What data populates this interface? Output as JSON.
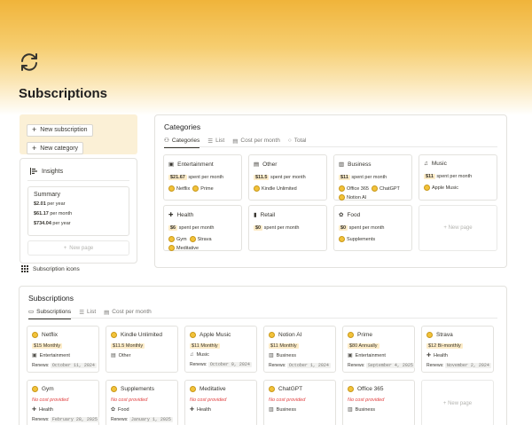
{
  "page": {
    "title": "Subscriptions",
    "icon": "refresh-icon"
  },
  "actions": {
    "new_subscription": "New subscription",
    "new_category": "New category"
  },
  "insights": {
    "title": "Insights",
    "summary_title": "Summary",
    "per_year": {
      "value": "$2.01",
      "label": "per year"
    },
    "per_month": {
      "value": "$61.17",
      "label": "per month"
    },
    "per_year_total": {
      "value": "$734.04",
      "label": "per year"
    },
    "new_page": "New page"
  },
  "subscription_icons": "Subscription icons",
  "categories": {
    "title": "Categories",
    "tabs": [
      "Categories",
      "List",
      "Cost per month",
      "Total"
    ],
    "cards": [
      {
        "name": "Entertainment",
        "spend_value": "$21.67",
        "spend_label": "spent per month",
        "items": [
          "Netflix",
          "Prime"
        ]
      },
      {
        "name": "Other",
        "spend_value": "$11.5",
        "spend_label": "spent per month",
        "items": [
          "Kindle Unlimited"
        ]
      },
      {
        "name": "Business",
        "spend_value": "$11",
        "spend_label": "spent per month",
        "items": [
          "Office 365",
          "ChatGPT",
          "Notion AI"
        ]
      },
      {
        "name": "Music",
        "spend_value": "$11",
        "spend_label": "spent per month",
        "items": [
          "Apple Music"
        ]
      },
      {
        "name": "Health",
        "spend_value": "$6",
        "spend_label": "spent per month",
        "items": [
          "Gym",
          "Strava",
          "Meditative"
        ]
      },
      {
        "name": "Retail",
        "spend_value": "$0",
        "spend_label": "spent per month",
        "items": []
      },
      {
        "name": "Food",
        "spend_value": "$0",
        "spend_label": "spent per month",
        "items": [
          "Supplements"
        ]
      }
    ],
    "new_page": "New page"
  },
  "subscriptions": {
    "title": "Subscriptions",
    "tabs": [
      "Subscriptions",
      "List",
      "Cost per month"
    ],
    "renews_label": "Renews:",
    "no_cost": "No cost provided",
    "cards": [
      {
        "name": "Netflix",
        "price": "$15",
        "period": "Monthly",
        "category": "Entertainment",
        "renews": "October 11, 2024"
      },
      {
        "name": "Kindle Unlimited",
        "price": "$11.5",
        "period": "Monthly",
        "category": "Other",
        "renews": ""
      },
      {
        "name": "Apple Music",
        "price": "$11",
        "period": "Monthly",
        "category": "Music",
        "renews": "October 9, 2024"
      },
      {
        "name": "Notion AI",
        "price": "$11",
        "period": "Monthly",
        "category": "Business",
        "renews": "October 1, 2024"
      },
      {
        "name": "Prime",
        "price": "$80",
        "period": "Annually",
        "category": "Entertainment",
        "renews": "September 4, 2025"
      },
      {
        "name": "Strava",
        "price": "$12",
        "period": "Bi-monthly",
        "category": "Health",
        "renews": "November 2, 2024"
      },
      {
        "name": "Gym",
        "price": "",
        "period": "",
        "category": "Health",
        "renews": "February 28, 2025"
      },
      {
        "name": "Supplements",
        "price": "",
        "period": "",
        "category": "Food",
        "renews": "January 1, 2025"
      },
      {
        "name": "Meditative",
        "price": "",
        "period": "",
        "category": "Health",
        "renews": ""
      },
      {
        "name": "ChatGPT",
        "price": "",
        "period": "",
        "category": "Business",
        "renews": ""
      },
      {
        "name": "Office 365",
        "price": "",
        "period": "",
        "category": "Business",
        "renews": ""
      }
    ],
    "new_page": "New page"
  }
}
